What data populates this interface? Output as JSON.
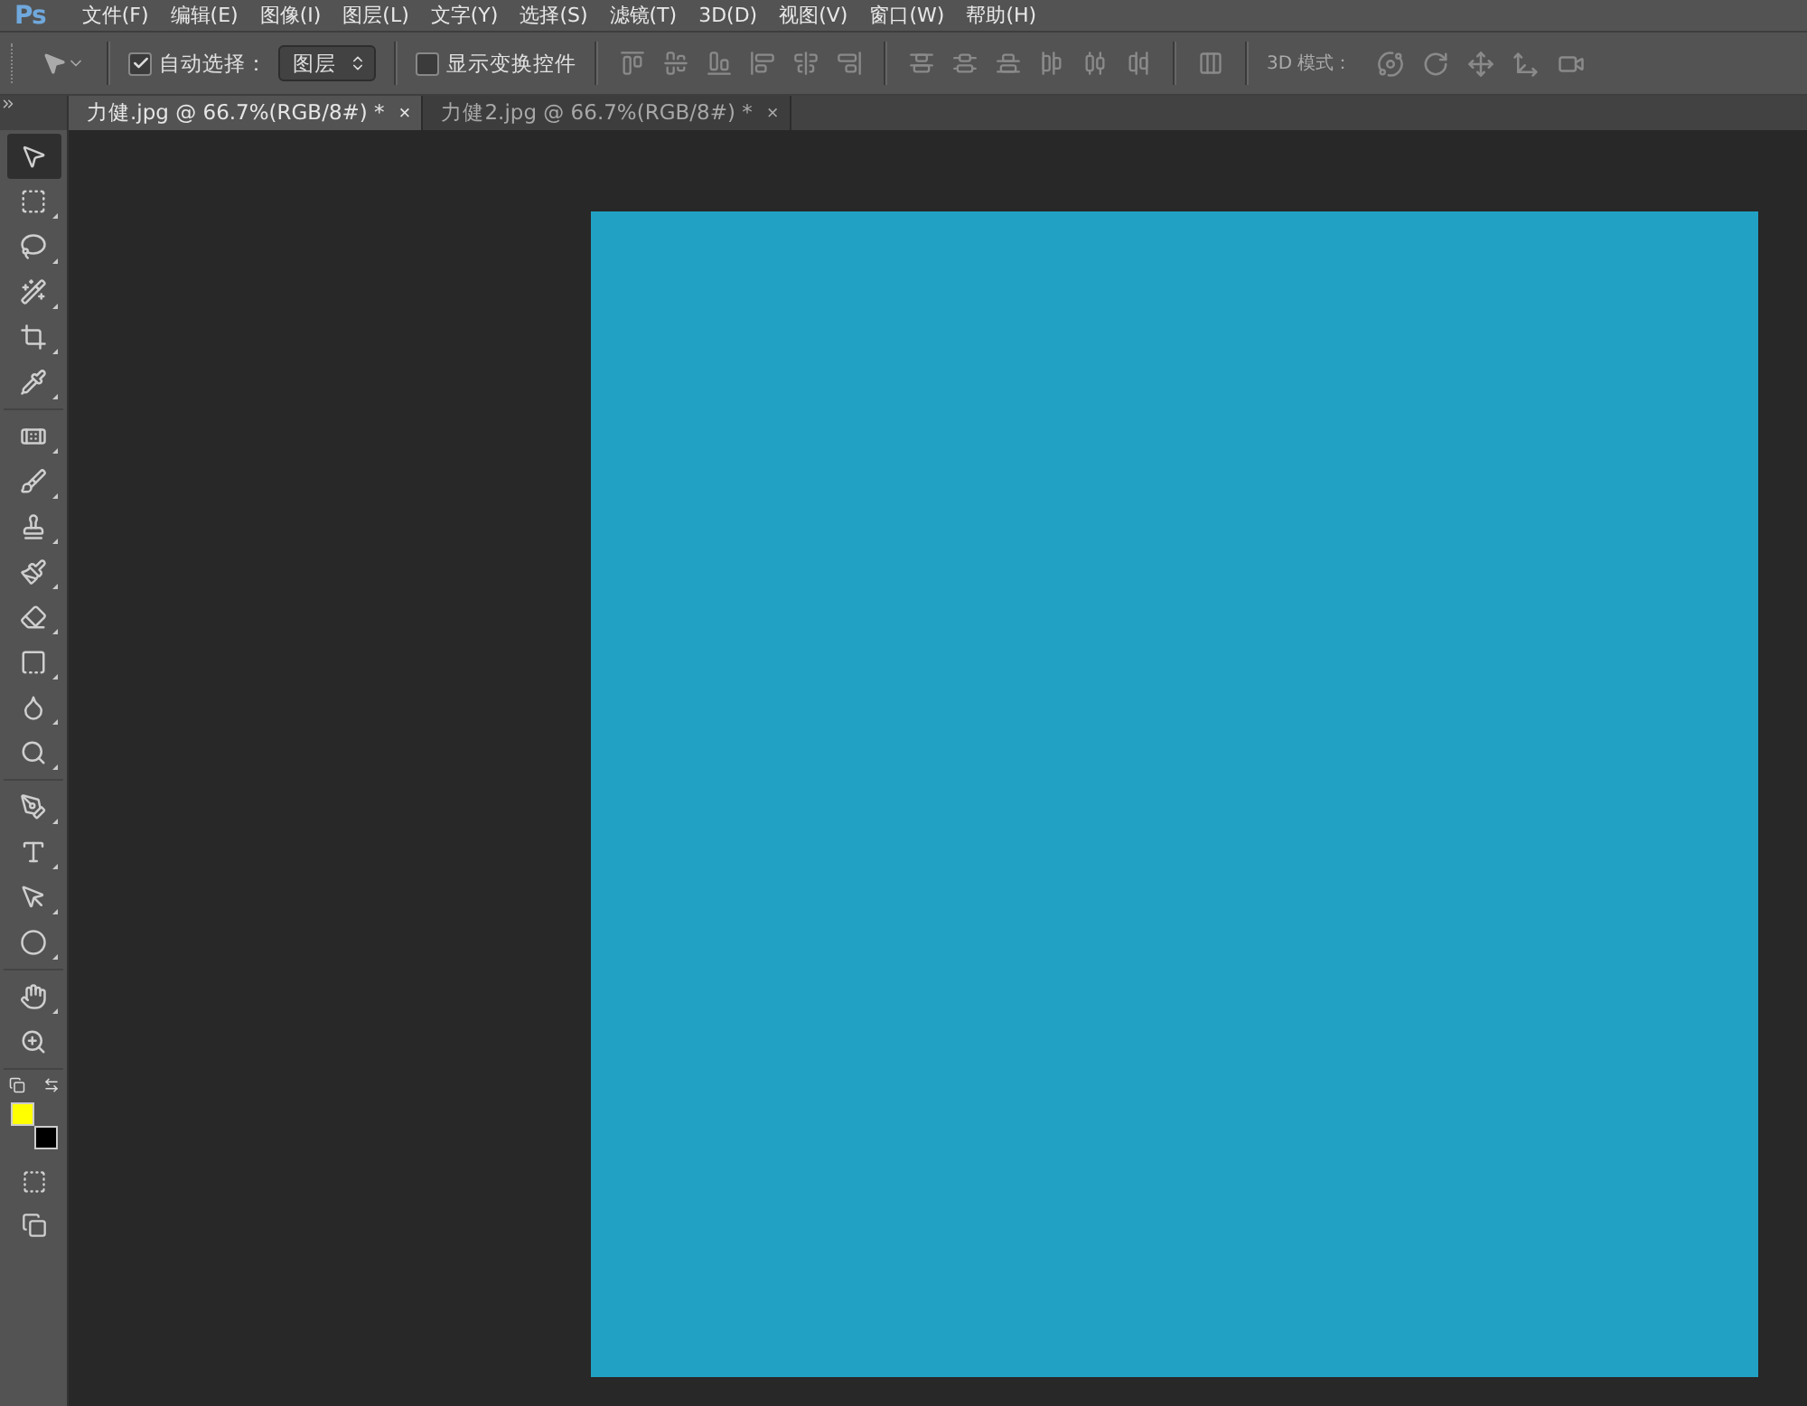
{
  "menu_bar": {
    "logo": "Ps",
    "items": [
      "文件(F)",
      "编辑(E)",
      "图像(I)",
      "图层(L)",
      "文字(Y)",
      "选择(S)",
      "滤镜(T)",
      "3D(D)",
      "视图(V)",
      "窗口(W)",
      "帮助(H)"
    ]
  },
  "options_bar": {
    "auto_select": {
      "label": "自动选择：",
      "checked": true
    },
    "target": {
      "value": "图层"
    },
    "show_transform": {
      "label": "显示变换控件",
      "checked": false
    },
    "mode_label": "3D 模式："
  },
  "tabs": [
    {
      "label": "力健.jpg @ 66.7%(RGB/8#) *",
      "close": "×",
      "selected": true
    },
    {
      "label": "力健2.jpg @ 66.7%(RGB/8#) *",
      "close": "×",
      "selected": false
    }
  ],
  "tool_groups": [
    {
      "tools": [
        {
          "kind": "move",
          "selected": true,
          "flyout": false
        },
        {
          "kind": "marquee",
          "selected": false,
          "flyout": true
        },
        {
          "kind": "lasso",
          "selected": false,
          "flyout": true
        },
        {
          "kind": "quick-select",
          "selected": false,
          "flyout": true
        },
        {
          "kind": "crop",
          "selected": false,
          "flyout": true
        },
        {
          "kind": "eyedropper",
          "selected": false,
          "flyout": true
        }
      ]
    },
    {
      "tools": [
        {
          "kind": "heal",
          "selected": false,
          "flyout": true
        },
        {
          "kind": "brush",
          "selected": false,
          "flyout": true
        },
        {
          "kind": "stamp",
          "selected": false,
          "flyout": true
        },
        {
          "kind": "history",
          "selected": false,
          "flyout": true
        },
        {
          "kind": "eraser",
          "selected": false,
          "flyout": true
        },
        {
          "kind": "gradient",
          "selected": false,
          "flyout": true
        },
        {
          "kind": "blur",
          "selected": false,
          "flyout": true
        },
        {
          "kind": "dodge",
          "selected": false,
          "flyout": true
        }
      ]
    },
    {
      "tools": [
        {
          "kind": "pen",
          "selected": false,
          "flyout": true
        },
        {
          "kind": "type",
          "selected": false,
          "flyout": true
        },
        {
          "kind": "path-select",
          "selected": false,
          "flyout": true
        },
        {
          "kind": "shape",
          "selected": false,
          "flyout": true
        }
      ]
    },
    {
      "tools": [
        {
          "kind": "hand",
          "selected": false,
          "flyout": true
        },
        {
          "kind": "zoom",
          "selected": false,
          "flyout": false
        }
      ]
    }
  ],
  "swatches": [
    {
      "kind": "foreground",
      "color": "#ffff00"
    },
    {
      "kind": "background",
      "color": "#000000"
    }
  ]
}
